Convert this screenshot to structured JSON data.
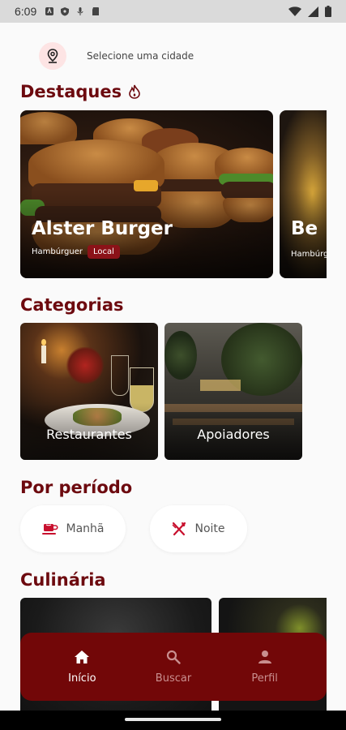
{
  "status_bar": {
    "time": "6:09"
  },
  "location": {
    "label": "Selecione uma cidade"
  },
  "highlights": {
    "title": "Destaques",
    "cards": [
      {
        "name": "Alster Burger",
        "category": "Hambúrguer",
        "tag": "Local"
      },
      {
        "name": "Be",
        "category": "Hambúrg"
      }
    ]
  },
  "categories": {
    "title": "Categorias",
    "items": [
      {
        "label": "Restaurantes"
      },
      {
        "label": "Apoiadores"
      }
    ]
  },
  "period": {
    "title": "Por período",
    "items": [
      {
        "label": "Manhã",
        "icon": "coffee-cup-icon"
      },
      {
        "label": "Noite",
        "icon": "fork-knife-icon"
      }
    ]
  },
  "cuisine": {
    "title": "Culinária"
  },
  "bottom_nav": {
    "items": [
      {
        "label": "Início",
        "icon": "home-icon",
        "active": true
      },
      {
        "label": "Buscar",
        "icon": "search-icon",
        "active": false
      },
      {
        "label": "Perfil",
        "icon": "person-icon",
        "active": false
      }
    ]
  },
  "colors": {
    "brand": "#720708",
    "accent": "#c8102e",
    "title": "#6d0a0f"
  }
}
